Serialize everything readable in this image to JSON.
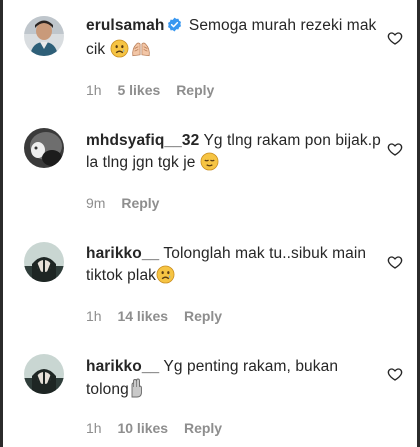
{
  "comments": [
    {
      "username": "erulsamah",
      "verified": true,
      "text": "Semoga murah rezeki mak cik",
      "emojis": [
        "sad-face-emoji",
        "folded-hands-emoji"
      ],
      "time": "1h",
      "likes": "5 likes",
      "reply": "Reply",
      "avatar_icon": "profile-photo-man"
    },
    {
      "username": "mhdsyafiq__32",
      "verified": false,
      "text": "Yg tlng rakam pon bijak.p la tlng jgn tgk je",
      "emojis": [
        "relieved-face-emoji"
      ],
      "time": "9m",
      "likes": "",
      "reply": "Reply",
      "avatar_icon": "profile-photo-dark"
    },
    {
      "username": "harikko__",
      "verified": false,
      "text": "Tolonglah mak tu..sibuk main tiktok plak",
      "emojis": [
        "sad-face-emoji"
      ],
      "time": "1h",
      "likes": "14 likes",
      "reply": "Reply",
      "avatar_icon": "profile-photo-anime"
    },
    {
      "username": "harikko__",
      "verified": false,
      "text": "Yg penting rakam, bukan tolong",
      "emojis": [
        "hand-gesture-emoji"
      ],
      "time": "1h",
      "likes": "10 likes",
      "reply": "Reply",
      "avatar_icon": "profile-photo-anime"
    }
  ],
  "colors": {
    "text": "#262626",
    "meta": "#8e8e8e",
    "verified": "#3897f0",
    "emoji": "#f6c443"
  }
}
